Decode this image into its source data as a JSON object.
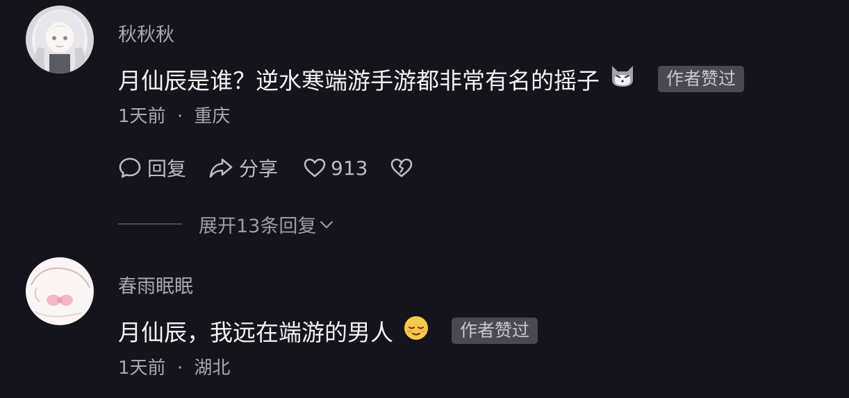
{
  "comments": [
    {
      "username": "秋秋秋",
      "text": "月仙辰是谁？逆水寒端游手游都非常有名的摇子",
      "emoji": "cat-face-emoji",
      "badge": "作者赞过",
      "time": "1天前",
      "separator": "·",
      "location": "重庆",
      "actions": {
        "reply_label": "回复",
        "share_label": "分享",
        "like_count": "913"
      },
      "expand_label": "展开13条回复"
    },
    {
      "username": "春雨眠眠",
      "text": "月仙辰，我远在端游的男人",
      "emoji": "relieved-face-emoji",
      "badge": "作者赞过",
      "time": "1天前",
      "separator": "·",
      "location": "湖北"
    }
  ],
  "colors": {
    "background": "#15141c",
    "username": "#a9a8b2",
    "text": "#f2f2f4",
    "badge_bg": "#4a4953"
  }
}
